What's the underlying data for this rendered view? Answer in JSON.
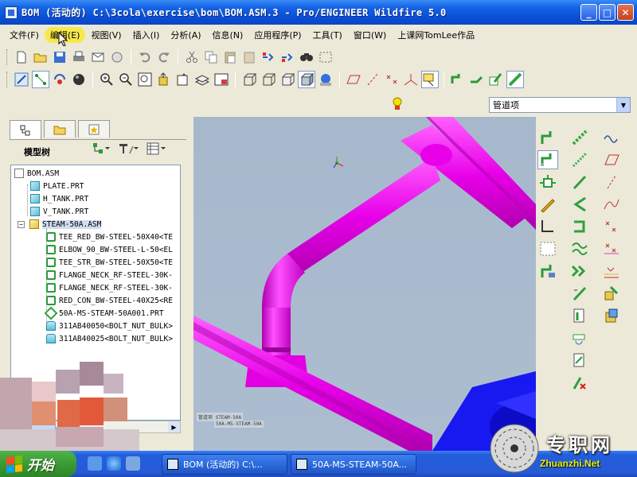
{
  "window": {
    "title": "BOM (活动的) C:\\3cola\\exercise\\bom\\BOM.ASM.3 - Pro/ENGINEER Wildfire 5.0",
    "minimize": "_",
    "maximize": "□",
    "close": "✕"
  },
  "menu": [
    {
      "label": "文件(F)"
    },
    {
      "label": "编辑(E)"
    },
    {
      "label": "视图(V)"
    },
    {
      "label": "插入(I)"
    },
    {
      "label": "分析(A)"
    },
    {
      "label": "信息(N)"
    },
    {
      "label": "应用程序(P)"
    },
    {
      "label": "工具(T)"
    },
    {
      "label": "窗口(W)"
    },
    {
      "label": "上课网TomLee作品"
    }
  ],
  "filter": {
    "value": "管道项",
    "arrow": "▼"
  },
  "model_tree": {
    "title": "模型树",
    "items": [
      {
        "label": "BOM.ASM",
        "type": "asm-root",
        "indent": 0
      },
      {
        "label": "PLATE.PRT",
        "type": "part",
        "indent": 1
      },
      {
        "label": "H_TANK.PRT",
        "type": "part",
        "indent": 1
      },
      {
        "label": "V_TANK.PRT",
        "type": "part",
        "indent": 1
      },
      {
        "label": "STEAM-50A.ASM",
        "type": "asm",
        "indent": 1
      },
      {
        "label": "TEE_RED_BW-STEEL-50X40<TE",
        "type": "fitting",
        "indent": 2
      },
      {
        "label": "ELBOW_90_BW-STEEL-L-50<EL",
        "type": "fitting",
        "indent": 2
      },
      {
        "label": "TEE_STR_BW-STEEL-50X50<TE",
        "type": "fitting",
        "indent": 2
      },
      {
        "label": "FLANGE_NECK_RF-STEEL-30K-",
        "type": "fitting",
        "indent": 2
      },
      {
        "label": "FLANGE_NECK_RF-STEEL-30K-",
        "type": "fitting",
        "indent": 2
      },
      {
        "label": "RED_CON_BW-STEEL-40X25<RE",
        "type": "fitting",
        "indent": 2
      },
      {
        "label": "50A-MS-STEAM-50A001.PRT",
        "type": "pipe",
        "indent": 2
      },
      {
        "label": "311AB40050<BOLT_NUT_BULK>",
        "type": "bolt",
        "indent": 2
      },
      {
        "label": "311AB40025<BOLT_NUT_BULK>",
        "type": "bolt",
        "indent": 2
      }
    ]
  },
  "viewport": {
    "labels": [
      "管道项 STEAM-50A",
      "50A-MS-STEAM-50A"
    ]
  },
  "taskbar": {
    "start": "开始",
    "tasks": [
      {
        "label": "BOM (活动的) C:\\..."
      },
      {
        "label": "50A-MS-STEAM-50A..."
      }
    ]
  },
  "watermark": {
    "text": "专职网",
    "url": "Zhuanzhi.Net"
  },
  "colors": {
    "pipe": "#e800e8",
    "tank": "#1010f0",
    "viewport_bg": "#a9bacd",
    "titlebar": "#0a4fd6"
  }
}
